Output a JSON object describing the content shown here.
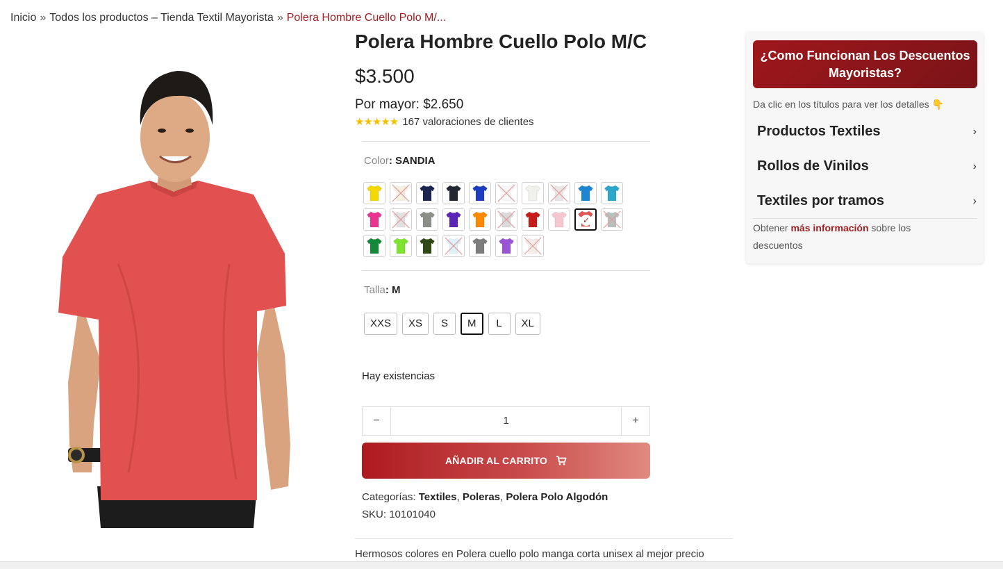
{
  "breadcrumb": {
    "home": "Inicio",
    "sep1": "»",
    "category": "Todos los productos – Tienda Textil Mayorista",
    "sep2": "»",
    "current": "Polera Hombre Cuello Polo M/..."
  },
  "product": {
    "title": "Polera Hombre Cuello Polo M/C",
    "price": "$3.500",
    "wholesale_label": "Por mayor: $2.650",
    "stars": "★★★★★",
    "reviews": "167 valoraciones de clientes",
    "color_label": "Color",
    "color_value": ": SANDIA",
    "talla_label": "Talla",
    "talla_value": ": M",
    "stock": "Hay existencias",
    "qty_minus": "−",
    "qty_value": "1",
    "qty_plus": "+",
    "add_to_cart": "AÑADIR AL CARRITO",
    "categories_label": "Categorías:",
    "categories": [
      "Textiles",
      "Poleras",
      "Polera Polo Algodón"
    ],
    "cat_sep": ",",
    "sku_label": "SKU:",
    "sku": "10101040",
    "description": "Hermosos colores en Polera cuello polo manga corta unisex al mejor precio"
  },
  "swatches": [
    {
      "color": "#f5d800",
      "state": "available"
    },
    {
      "color": "#efe3c8",
      "state": "unavailable"
    },
    {
      "color": "#1b2550",
      "state": "available"
    },
    {
      "color": "#222831",
      "state": "available"
    },
    {
      "color": "#1d3fbf",
      "state": "available"
    },
    {
      "color": "#f3f3f3",
      "state": "unavailable"
    },
    {
      "color": "#f1f1ee",
      "state": "available"
    },
    {
      "color": "#d9d2d4",
      "state": "unavailable"
    },
    {
      "color": "#1d86d3",
      "state": "available"
    },
    {
      "color": "#2aa7c9",
      "state": "available"
    },
    {
      "color": "#e9358f",
      "state": "available"
    },
    {
      "color": "#c9c9c9",
      "state": "unavailable"
    },
    {
      "color": "#8c8f88",
      "state": "available"
    },
    {
      "color": "#5b23b8",
      "state": "available"
    },
    {
      "color": "#ff8a00",
      "state": "available"
    },
    {
      "color": "#bcbcbc",
      "state": "unavailable"
    },
    {
      "color": "#c81c1c",
      "state": "available"
    },
    {
      "color": "#f6c7cf",
      "state": "available"
    },
    {
      "color": "#e25555",
      "state": "selected"
    },
    {
      "color": "#7f8c87",
      "state": "unavailable"
    },
    {
      "color": "#138a3a",
      "state": "available"
    },
    {
      "color": "#7fe331",
      "state": "available"
    },
    {
      "color": "#2f4a16",
      "state": "available"
    },
    {
      "color": "#bfe6f2",
      "state": "unavailable"
    },
    {
      "color": "#7d7d7d",
      "state": "available"
    },
    {
      "color": "#9a55d6",
      "state": "available"
    },
    {
      "color": "#e7dfd2",
      "state": "unavailable"
    }
  ],
  "sizes": [
    {
      "label": "XXS",
      "selected": false
    },
    {
      "label": "XS",
      "selected": false
    },
    {
      "label": "S",
      "selected": false
    },
    {
      "label": "M",
      "selected": true
    },
    {
      "label": "L",
      "selected": false
    },
    {
      "label": "XL",
      "selected": false
    }
  ],
  "sidebar": {
    "banner": "¿Como Funcionan Los Descuentos Mayoristas?",
    "hint": "Da clic en los títulos para ver los detalles 👇",
    "sections": [
      "Productos Textiles",
      "Rollos de Vinilos",
      "Textiles por tramos"
    ],
    "chevron": "›",
    "info_pre": "Obtener ",
    "info_link": "más información",
    "info_post": " sobre los descuentos"
  },
  "colors": {
    "accent": "#a11d22",
    "star": "#f2c200",
    "model_shirt": "#e0514f"
  }
}
